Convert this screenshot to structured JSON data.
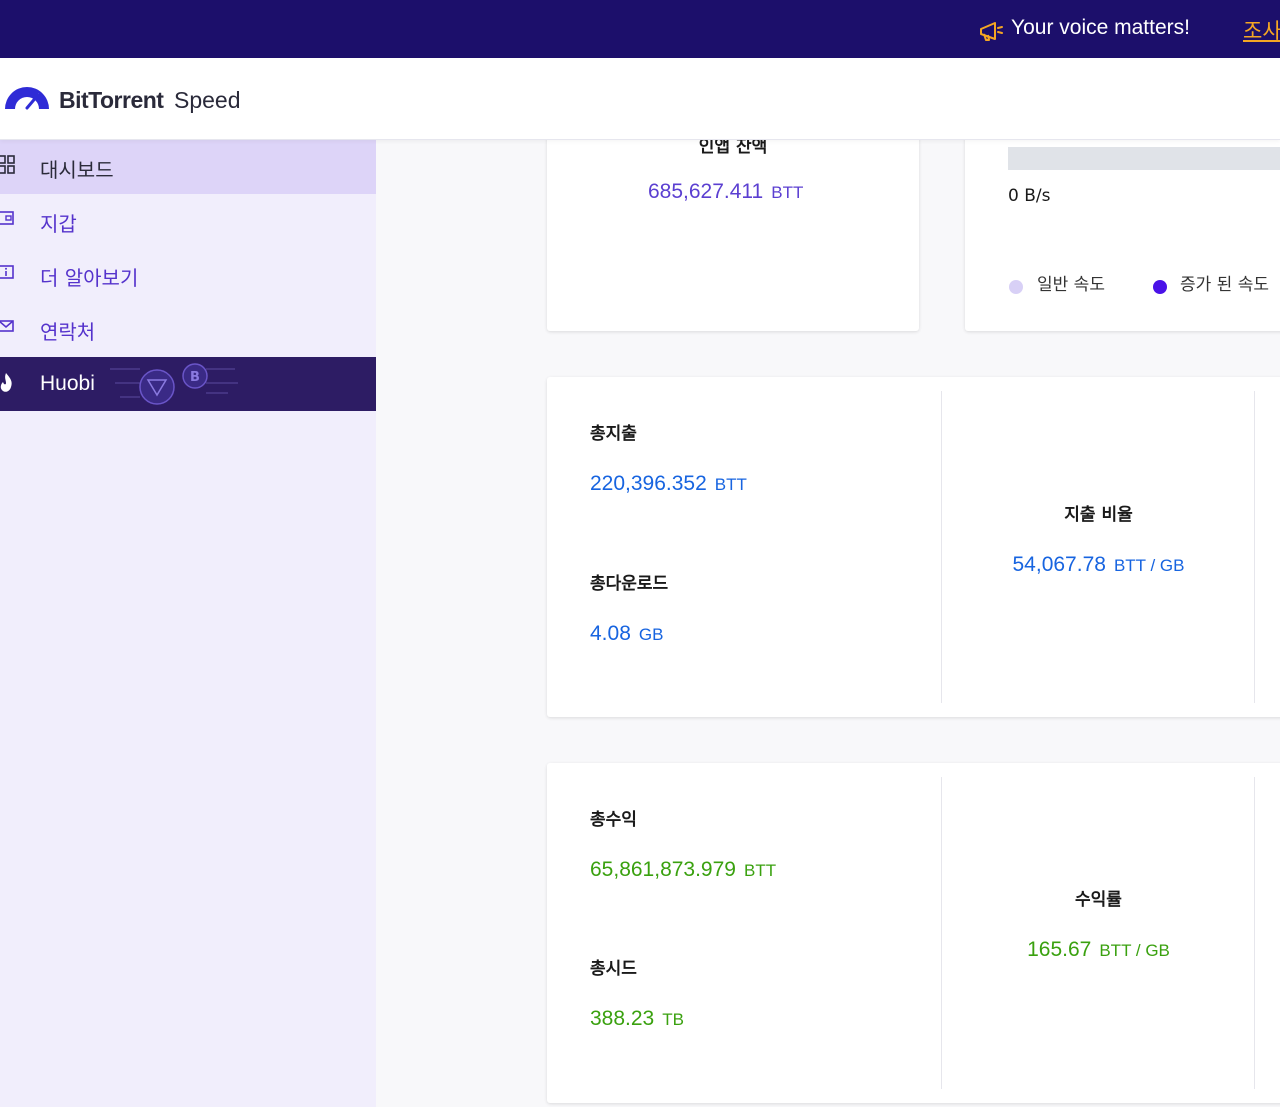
{
  "banner": {
    "text": "Your voice matters!",
    "link": "조사"
  },
  "header": {
    "logo_bold": "BitTorrent",
    "logo_light": "Speed"
  },
  "sidebar": {
    "items": [
      {
        "label": "대시보드",
        "icon": "dashboard-icon"
      },
      {
        "label": "지갑",
        "icon": "wallet-icon"
      },
      {
        "label": "더 알아보기",
        "icon": "info-icon"
      },
      {
        "label": "연락처",
        "icon": "mail-icon"
      },
      {
        "label": "Huobi",
        "icon": "huobi-flame-icon"
      }
    ]
  },
  "balance_card": {
    "title": "인앱 잔액",
    "value": "685,627.411",
    "unit": "BTT"
  },
  "speed_card": {
    "speed": "0 B/s",
    "legend": [
      {
        "label": "일반 속도",
        "color": "#d8d0f6"
      },
      {
        "label": "증가 된 속도",
        "color": "#4a12e8"
      }
    ]
  },
  "spend_card": {
    "total_spent_label": "총지출",
    "total_spent_value": "220,396.352",
    "total_spent_unit": "BTT",
    "total_download_label": "총다운로드",
    "total_download_value": "4.08",
    "total_download_unit": "GB",
    "spend_rate_label": "지출 비율",
    "spend_rate_value": "54,067.78",
    "spend_rate_unit": "BTT / GB"
  },
  "earn_card": {
    "total_earned_label": "총수익",
    "total_earned_value": "65,861,873.979",
    "total_earned_unit": "BTT",
    "total_seed_label": "총시드",
    "total_seed_value": "388.23",
    "total_seed_unit": "TB",
    "earn_rate_label": "수익률",
    "earn_rate_value": "165.67",
    "earn_rate_unit": "BTT / GB"
  },
  "colors": {
    "banner_bg": "#1c0f6b",
    "accent_purple": "#5b3fd1",
    "spend_blue": "#1764e0",
    "earn_green": "#3aa10f"
  }
}
